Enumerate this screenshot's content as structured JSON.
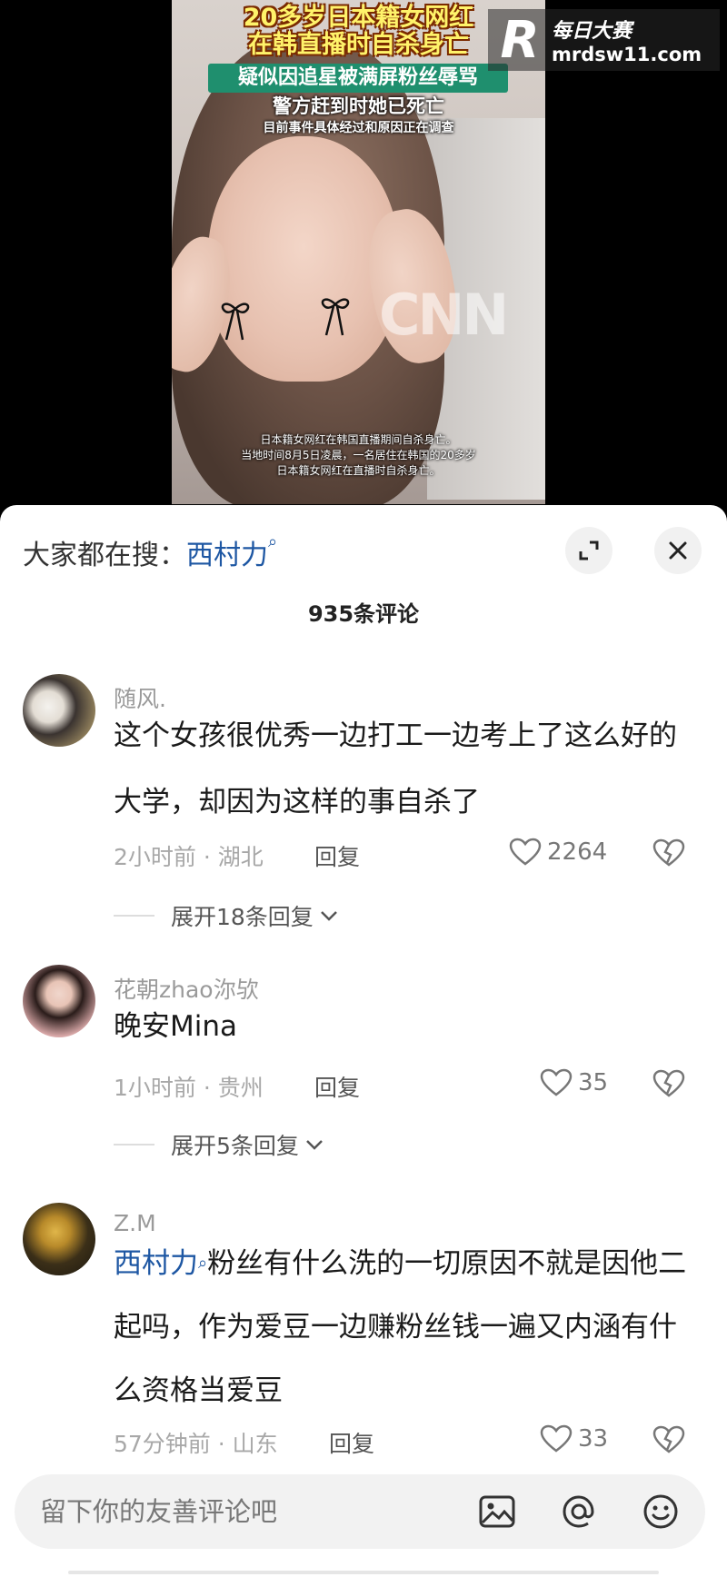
{
  "video": {
    "caption_line1": "20多岁日本籍女网红",
    "caption_line2": "在韩直播时自杀身亡",
    "caption_line3": "疑似因追星被满屏粉丝辱骂",
    "caption_line4": "警方赶到时她已死亡",
    "caption_line5": "目前事件具体经过和原因正在调查",
    "subtitle_line1": "日本籍女网红在韩国直播期间自杀身亡。",
    "subtitle_line2": "当地时间8月5日凌晨，一名居住在韩国的20多岁",
    "subtitle_line3": "日本籍女网红在直播时自杀身亡。",
    "news_logo": "CNN",
    "watermark_logo": "R",
    "watermark_title": "每日大赛",
    "watermark_url": "mrdsw11.com"
  },
  "search": {
    "prefix": "大家都在搜：",
    "term": "西村力"
  },
  "comment_count": "935条评论",
  "comments": [
    {
      "username": "随风.",
      "text": "这个女孩很优秀一边打工一边考上了这么好的大学，却因为这样的事自杀了",
      "time_location": "2小时前 · 湖北",
      "reply_label": "回复",
      "likes": "2264",
      "expand_label": "展开18条回复"
    },
    {
      "username": "花朝zhao沵欤",
      "text": "晚安Mina",
      "time_location": "1小时前 · 贵州",
      "reply_label": "回复",
      "likes": "35",
      "expand_label": "展开5条回复"
    },
    {
      "username": "Z.M",
      "mention": "西村力",
      "text": "粉丝有什么洗的一切原因不就是因他二起吗，作为爱豆一边赚粉丝钱一遍又内涵有什么资格当爱豆",
      "time_location": "57分钟前 · 山东",
      "reply_label": "回复",
      "likes": "33"
    }
  ],
  "input": {
    "placeholder": "留下你的友善评论吧"
  },
  "icons": {
    "image": "image-icon",
    "at": "at-icon",
    "emoji": "emoji-icon",
    "expand": "expand-icon",
    "close": "close-icon",
    "heart": "heart-icon",
    "dislike": "broken-heart-icon"
  },
  "colors": {
    "link": "#1e57a3",
    "caption_highlight": "#fff36a",
    "caption_banner": "#1f8f6e"
  }
}
